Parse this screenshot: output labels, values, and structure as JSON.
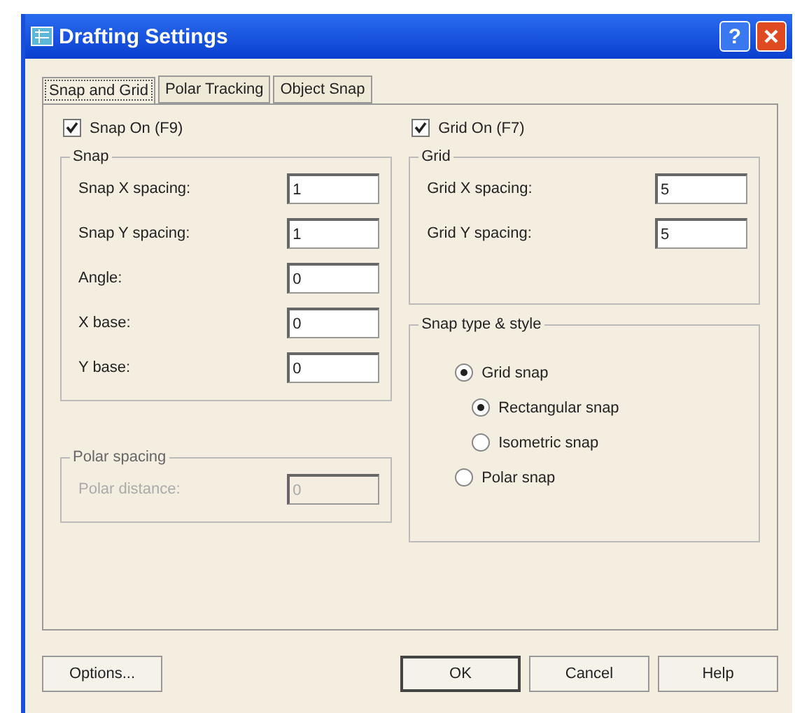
{
  "window": {
    "title": "Drafting Settings",
    "help_button": "?"
  },
  "tabs": [
    {
      "label": "Snap and Grid",
      "selected": true
    },
    {
      "label": "Polar Tracking",
      "selected": false
    },
    {
      "label": "Object Snap",
      "selected": false
    }
  ],
  "snap_on": {
    "label": "Snap On (F9)",
    "checked": true
  },
  "snap": {
    "title": "Snap",
    "fields": [
      {
        "label": "Snap X spacing:",
        "value": "1"
      },
      {
        "label": "Snap Y spacing:",
        "value": "1"
      },
      {
        "label": "Angle:",
        "value": "0"
      },
      {
        "label": "X base:",
        "value": "0"
      },
      {
        "label": "Y base:",
        "value": "0"
      }
    ]
  },
  "polar_spacing": {
    "title": "Polar spacing",
    "disabled": true,
    "fields": [
      {
        "label": "Polar distance:",
        "value": "0"
      }
    ]
  },
  "grid_on": {
    "label": "Grid On (F7)",
    "checked": true
  },
  "grid": {
    "title": "Grid",
    "fields": [
      {
        "label": "Grid X spacing:",
        "value": "5"
      },
      {
        "label": "Grid Y spacing:",
        "value": "5"
      }
    ]
  },
  "snap_type": {
    "title": "Snap type & style",
    "options": [
      {
        "label": "Grid snap",
        "selected": true,
        "children": [
          {
            "label": "Rectangular snap",
            "selected": true
          },
          {
            "label": "Isometric snap",
            "selected": false
          }
        ]
      },
      {
        "label": "Polar snap",
        "selected": false
      }
    ]
  },
  "buttons": [
    {
      "label": "Options...",
      "default": false
    },
    {
      "label": "OK",
      "default": true
    },
    {
      "label": "Cancel",
      "default": false
    },
    {
      "label": "Help",
      "default": false
    }
  ]
}
